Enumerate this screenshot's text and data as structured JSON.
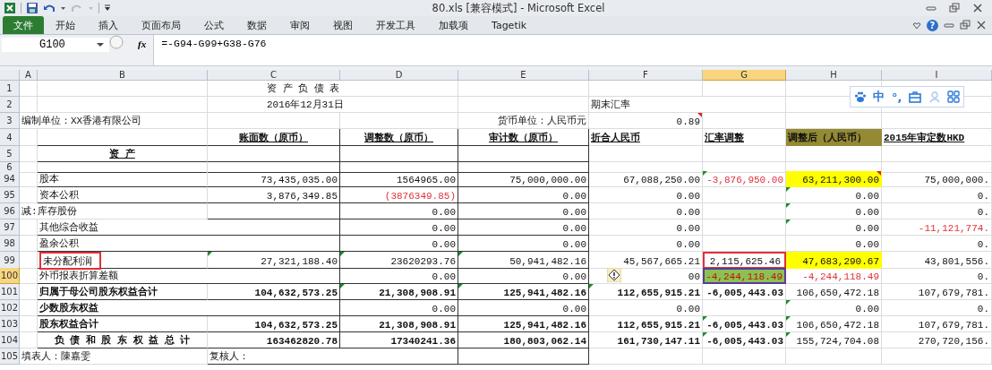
{
  "window": {
    "title": "80.xls  [兼容模式]  -  Microsoft Excel"
  },
  "ribbon_tabs": [
    {
      "label": "文件",
      "kind": "file"
    },
    {
      "label": "开始",
      "kind": "tab"
    },
    {
      "label": "插入",
      "kind": "tab"
    },
    {
      "label": "页面布局",
      "kind": "tab"
    },
    {
      "label": "公式",
      "kind": "tab"
    },
    {
      "label": "数据",
      "kind": "tab"
    },
    {
      "label": "审阅",
      "kind": "tab"
    },
    {
      "label": "视图",
      "kind": "tab"
    },
    {
      "label": "开发工具",
      "kind": "tab"
    },
    {
      "label": "加载项",
      "kind": "tab"
    },
    {
      "label": "Tagetik",
      "kind": "tab"
    }
  ],
  "help_label": "?",
  "formula_bar": {
    "name_box": "G100",
    "fx_label": "fx",
    "formula": "=-G94-G99+G38-G76"
  },
  "columns": [
    {
      "label": "A",
      "selected": false
    },
    {
      "label": "B",
      "selected": false
    },
    {
      "label": "C",
      "selected": false
    },
    {
      "label": "D",
      "selected": false
    },
    {
      "label": "E",
      "selected": false
    },
    {
      "label": "F",
      "selected": false
    },
    {
      "label": "G",
      "selected": true
    },
    {
      "label": "H",
      "selected": false
    },
    {
      "label": "I",
      "selected": false
    }
  ],
  "rows": [
    {
      "label": "1",
      "selected": false,
      "cells": {
        "C": {
          "text": "资 产 负 债 表",
          "kind": "title"
        }
      }
    },
    {
      "label": "2",
      "selected": false,
      "cells": {
        "C": {
          "text": "2016年12月31日",
          "kind": "title"
        },
        "F": {
          "text": "期末汇率",
          "kind": "text"
        }
      }
    },
    {
      "label": "3",
      "selected": false,
      "cells": {
        "A": {
          "text": "编制单位：XX香港有限公司",
          "kind": "text"
        },
        "E": {
          "text": "货币单位：人民币元",
          "kind": "caption"
        },
        "F": {
          "text": "0.89",
          "kind": "number",
          "comment": true
        }
      }
    },
    {
      "label": "4",
      "selected": false,
      "cells": {
        "C": {
          "text": "账面数（原币）",
          "kind": "heading",
          "bold": true,
          "underline": true
        },
        "D": {
          "text": "调整数（原币）",
          "kind": "heading",
          "bold": true,
          "underline": true
        },
        "E": {
          "text": "审计数（原币）",
          "kind": "heading",
          "bold": true,
          "underline": true
        },
        "F": {
          "text": "折合人民币",
          "kind": "text",
          "bold": true,
          "underline": true
        },
        "G": {
          "text": "汇率调整",
          "kind": "text",
          "bold": true,
          "underline": true
        },
        "H": {
          "text": "调整后（人民币）",
          "kind": "text",
          "bold": true,
          "color": "#948a34"
        },
        "I": {
          "text": "2015年审定数HKD",
          "kind": "text",
          "bold": true,
          "underline": true
        }
      }
    },
    {
      "label": "5",
      "selected": false,
      "cells": {
        "B": {
          "text": "资 产",
          "kind": "heading",
          "bold": true,
          "underline": true
        }
      }
    },
    {
      "label": "6",
      "selected": false
    },
    {
      "label": "94",
      "selected": false,
      "cells": {
        "B": {
          "text": "股本",
          "kind": "text"
        },
        "C": {
          "text": "73,435,035.00",
          "kind": "number"
        },
        "D": {
          "text": "1564965.00",
          "kind": "number"
        },
        "E": {
          "text": "75,000,000.00",
          "kind": "number"
        },
        "F": {
          "text": "67,088,250.00",
          "kind": "number"
        },
        "G": {
          "text": "-3,876,950.00",
          "kind": "number",
          "red": true,
          "warning": true
        },
        "H": {
          "text": "63,211,300.00",
          "kind": "number",
          "color": "#ffff00",
          "comment": true
        },
        "I": {
          "text": "75,000,000.",
          "kind": "number"
        }
      }
    },
    {
      "label": "95",
      "selected": false,
      "cells": {
        "B": {
          "text": "资本公积",
          "kind": "text"
        },
        "C": {
          "text": "3,876,349.85",
          "kind": "number"
        },
        "D": {
          "text": "(3876349.85)",
          "kind": "number",
          "red": true
        },
        "E": {
          "text": "0.00",
          "kind": "number"
        },
        "F": {
          "text": "0.00",
          "kind": "number"
        },
        "H": {
          "text": "0.00",
          "kind": "number",
          "warning": true
        },
        "I": {
          "text": "0.",
          "kind": "number"
        }
      }
    },
    {
      "label": "96",
      "selected": false,
      "cells": {
        "A": {
          "text": "减:库存股份",
          "kind": "text"
        },
        "D": {
          "text": "0.00",
          "kind": "number"
        },
        "E": {
          "text": "0.00",
          "kind": "number"
        },
        "F": {
          "text": "0.00",
          "kind": "number"
        },
        "H": {
          "text": "0.00",
          "kind": "number",
          "warning": true
        },
        "I": {
          "text": "0.",
          "kind": "number"
        }
      }
    },
    {
      "label": "97",
      "selected": false,
      "cells": {
        "B": {
          "text": "其他综合收益",
          "kind": "text"
        },
        "D": {
          "text": "0.00",
          "kind": "number"
        },
        "E": {
          "text": "0.00",
          "kind": "number"
        },
        "F": {
          "text": "0.00",
          "kind": "number"
        },
        "H": {
          "text": "0.00",
          "kind": "number",
          "warning": true
        },
        "I": {
          "text": "-11,121,774.",
          "kind": "number",
          "red": true
        }
      }
    },
    {
      "label": "98",
      "selected": false,
      "cells": {
        "B": {
          "text": "盈余公积",
          "kind": "text"
        },
        "D": {
          "text": "0.00",
          "kind": "number"
        },
        "E": {
          "text": "0.00",
          "kind": "number"
        },
        "F": {
          "text": "0.00",
          "kind": "number"
        },
        "H": {
          "text": "0.00",
          "kind": "number"
        },
        "I": {
          "text": "0.",
          "kind": "number"
        }
      }
    },
    {
      "label": "99",
      "selected": false,
      "cells": {
        "B": {
          "text": "未分配利润",
          "kind": "text",
          "boxed": true
        },
        "C": {
          "text": "27,321,188.40",
          "kind": "number",
          "warning": true
        },
        "D": {
          "text": "23620293.76",
          "kind": "number",
          "warning": true
        },
        "E": {
          "text": "50,941,482.16",
          "kind": "number",
          "warning": true
        },
        "F": {
          "text": "45,567,665.21",
          "kind": "number"
        },
        "G": {
          "text": "2,115,625.46",
          "kind": "number",
          "boxed": true
        },
        "H": {
          "text": "47,683,290.67",
          "kind": "number",
          "color": "#ffff00"
        },
        "I": {
          "text": "43,801,556.",
          "kind": "number"
        }
      }
    },
    {
      "label": "100",
      "selected": true,
      "cells": {
        "B": {
          "text": "外币报表折算差额",
          "kind": "text"
        },
        "D": {
          "text": "0.00",
          "kind": "number"
        },
        "E": {
          "text": "0.00",
          "kind": "number"
        },
        "F": {
          "text": "00",
          "kind": "number",
          "error_tag": true
        },
        "G": {
          "text": "-4,244,118.49",
          "kind": "number",
          "red": true,
          "color": "#8cc152"
        },
        "H": {
          "text": "-4,244,118.49",
          "kind": "number",
          "red": true
        },
        "I": {
          "text": "0.",
          "kind": "number"
        }
      }
    },
    {
      "label": "101",
      "selected": false,
      "cells": {
        "B": {
          "text": "归属于母公司股东权益合计",
          "kind": "text",
          "bold": true
        },
        "C": {
          "text": "104,632,573.25",
          "kind": "number",
          "bold": true
        },
        "D": {
          "text": "21,308,908.91",
          "kind": "number",
          "bold": true,
          "warning": true
        },
        "E": {
          "text": "125,941,482.16",
          "kind": "number",
          "bold": true,
          "warning": true
        },
        "F": {
          "text": "112,655,915.21",
          "kind": "number",
          "bold": true,
          "warning": true
        },
        "G": {
          "text": "-6,005,443.03",
          "kind": "number",
          "bold": true
        },
        "H": {
          "text": "106,650,472.18",
          "kind": "number"
        },
        "I": {
          "text": "107,679,781.",
          "kind": "number"
        }
      }
    },
    {
      "label": "102",
      "selected": false,
      "cells": {
        "B": {
          "text": "少数股东权益",
          "kind": "text",
          "bold": true
        },
        "D": {
          "text": "0.00",
          "kind": "number"
        },
        "E": {
          "text": "0.00",
          "kind": "number"
        },
        "F": {
          "text": "0.00",
          "kind": "number"
        },
        "H": {
          "text": "0.00",
          "kind": "number",
          "warning": true
        },
        "I": {
          "text": "0.",
          "kind": "number"
        }
      }
    },
    {
      "label": "103",
      "selected": false,
      "cells": {
        "B": {
          "text": "股东权益合计",
          "kind": "text",
          "bold": true
        },
        "C": {
          "text": "104,632,573.25",
          "kind": "number",
          "bold": true
        },
        "D": {
          "text": "21,308,908.91",
          "kind": "number",
          "bold": true
        },
        "E": {
          "text": "125,941,482.16",
          "kind": "number",
          "bold": true
        },
        "F": {
          "text": "112,655,915.21",
          "kind": "number",
          "bold": true
        },
        "G": {
          "text": "-6,005,443.03",
          "kind": "number",
          "bold": true,
          "warning": true
        },
        "H": {
          "text": "106,650,472.18",
          "kind": "number",
          "warning": true
        },
        "I": {
          "text": "107,679,781.",
          "kind": "number"
        }
      }
    },
    {
      "label": "104",
      "selected": false,
      "cells": {
        "B": {
          "text": "负 债 和 股 东 权 益 总 计",
          "kind": "heading",
          "bold": true
        },
        "C": {
          "text": "163462820.78",
          "kind": "number",
          "bold": true
        },
        "D": {
          "text": "17340241.36",
          "kind": "number",
          "bold": true
        },
        "E": {
          "text": "180,803,062.14",
          "kind": "number",
          "bold": true
        },
        "F": {
          "text": "161,730,147.11",
          "kind": "number",
          "bold": true
        },
        "G": {
          "text": "-6,005,443.03",
          "kind": "number",
          "bold": true,
          "warning": true
        },
        "H": {
          "text": "155,724,704.08",
          "kind": "number",
          "warning": true
        },
        "I": {
          "text": "270,720,156.",
          "kind": "number"
        }
      }
    },
    {
      "label": "105",
      "selected": false,
      "cells": {
        "A": {
          "text": "填表人：陳嘉雯",
          "kind": "text"
        },
        "C": {
          "text": "复核人：",
          "kind": "text"
        }
      }
    }
  ],
  "ime_toolbar": {
    "labels": [
      "中",
      "°,"
    ]
  }
}
